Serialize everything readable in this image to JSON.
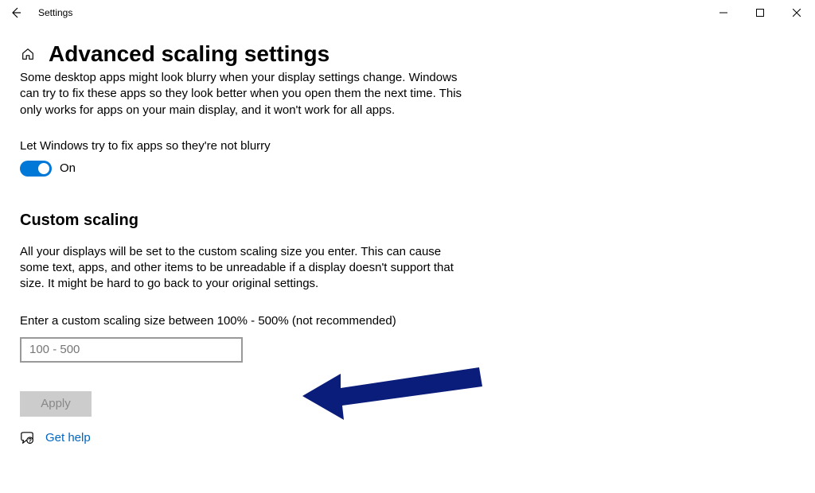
{
  "window": {
    "title": "Settings"
  },
  "page": {
    "title": "Advanced scaling settings"
  },
  "fix_blurry": {
    "description": "Some desktop apps might look blurry when your display settings change. Windows can try to fix these apps so they look better when you open them the next time. This only works for apps on your main display, and it won't work for all apps.",
    "toggle_label": "Let Windows try to fix apps so they're not blurry",
    "toggle_state": "On"
  },
  "custom_scaling": {
    "heading": "Custom scaling",
    "description": "All your displays will be set to the custom scaling size you enter. This can cause some text, apps, and other items to be unreadable if a display doesn't support that size. It might be hard to go back to your original settings.",
    "input_label": "Enter a custom scaling size between 100% - 500% (not recommended)",
    "input_placeholder": "100 - 500",
    "input_value": "",
    "apply_label": "Apply"
  },
  "help": {
    "link_text": "Get help"
  },
  "colors": {
    "accent": "#0078d7",
    "link": "#0067c0",
    "arrow": "#0b1d7b"
  }
}
